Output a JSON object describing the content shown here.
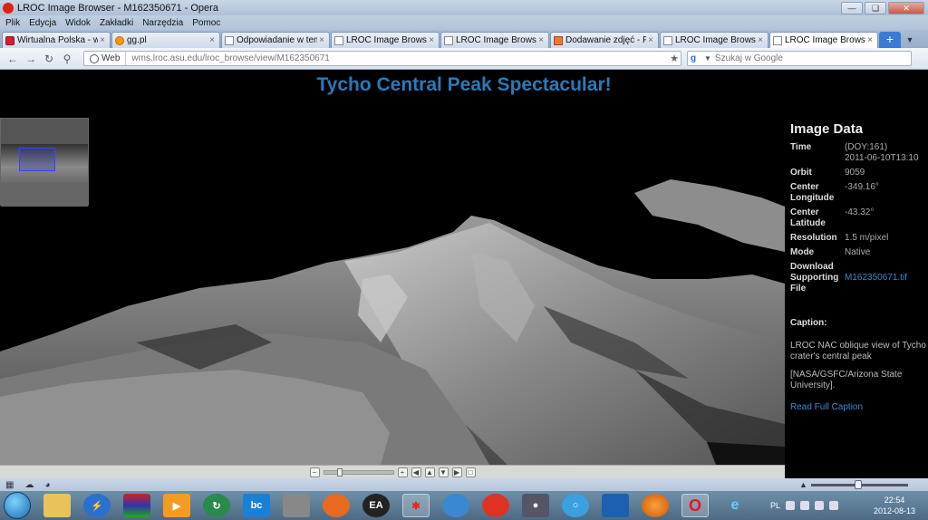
{
  "window": {
    "title": "LROC Image Browser - M162350671 - Opera"
  },
  "menu": [
    "Plik",
    "Edycja",
    "Widok",
    "Zakładki",
    "Narzędzia",
    "Pomoc"
  ],
  "tabs": [
    {
      "label": "Wirtualna Polska - w...",
      "icon": "wp-favicon"
    },
    {
      "label": "gg.pl",
      "icon": "gg-favicon"
    },
    {
      "label": "Odpowiadanie w tem...",
      "icon": "page-favicon"
    },
    {
      "label": "LROC Image Browser",
      "icon": "page-favicon"
    },
    {
      "label": "LROC Image Browser...",
      "icon": "page-favicon"
    },
    {
      "label": "Dodawanie zdjęć - Fo...",
      "icon": "forum-favicon"
    },
    {
      "label": "LROC Image Browser...",
      "icon": "page-favicon"
    },
    {
      "label": "LROC Image Browser...",
      "icon": "page-favicon",
      "active": true
    }
  ],
  "address": {
    "web_label": "Web",
    "url": "wms.lroc.asu.edu/lroc_browse/view/M162350671",
    "search_placeholder": "Szukaj w Google"
  },
  "page": {
    "title": "Tycho Central Peak Spectacular!",
    "panel_heading": "Image Data",
    "rows": [
      {
        "key": "Time",
        "value": "(DOY:161)"
      },
      {
        "key": "",
        "value": "2011-06-10T13:10"
      },
      {
        "key": "Orbit",
        "value": "9059"
      },
      {
        "key": "Center Longitude",
        "value": "-349.16°"
      },
      {
        "key": "Center Latitude",
        "value": "-43.32°"
      },
      {
        "key": "Resolution",
        "value": "1.5 m/pixel"
      },
      {
        "key": "Mode",
        "value": "Native"
      },
      {
        "key": "Download Supporting File",
        "value": "M162350671.tif"
      }
    ],
    "caption_heading": "Caption:",
    "caption_text": "LROC NAC oblique view of Tycho crater's central peak",
    "caption_credit": "[NASA/GSFC/Arizona State University].",
    "full_caption_link": "Read Full Caption"
  },
  "taskbar": {
    "language": "PL",
    "time": "22:54",
    "date": "2012-08-13"
  },
  "colors": {
    "title_blue": "#2a7ab8",
    "link_blue": "#3a8ccf"
  }
}
